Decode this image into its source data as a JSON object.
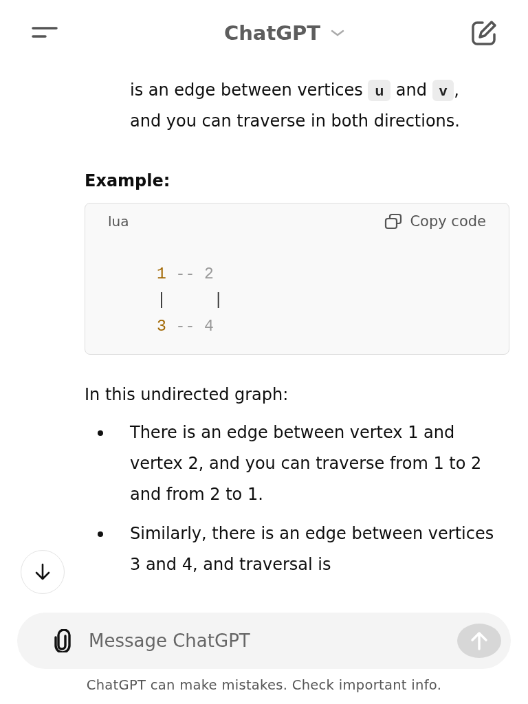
{
  "header": {
    "title": "ChatGPT"
  },
  "intro": [
    {
      "text": "is an edge between vertices ",
      "kind": "text"
    },
    {
      "text": "u",
      "kind": "code"
    },
    {
      "text": " and ",
      "kind": "text"
    },
    {
      "text": "v",
      "kind": "code"
    },
    {
      "text": ", and you can traverse in both directions.",
      "kind": "text"
    }
  ],
  "example_heading": "Example:",
  "code_block": {
    "language": "lua",
    "copy_label": "Copy code",
    "lines": [
      [
        {
          "text": "1",
          "kind": "number"
        },
        {
          "text": " -- 2",
          "kind": "comment"
        }
      ],
      [
        {
          "text": "|     |",
          "kind": "plain"
        }
      ],
      [
        {
          "text": "3",
          "kind": "number"
        },
        {
          "text": " -- 4",
          "kind": "comment"
        }
      ]
    ]
  },
  "list_intro": "In this undirected graph:",
  "bullets": [
    "There is an edge between vertex 1 and vertex 2, and you can traverse from 1 to 2 and from 2 to 1.",
    "Similarly, there is an edge between vertices 3 and 4, and traversal is"
  ],
  "composer": {
    "placeholder": "Message ChatGPT",
    "send_disabled": true
  },
  "disclaimer": "ChatGPT can make mistakes. Check important info."
}
